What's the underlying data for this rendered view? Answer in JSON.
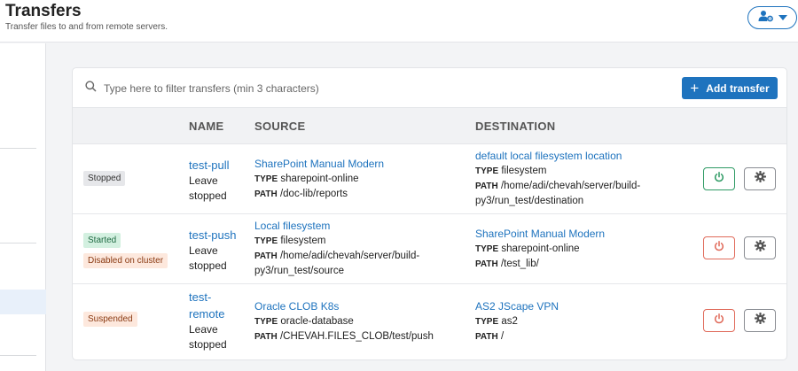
{
  "header": {
    "title": "Transfers",
    "subtitle": "Transfer files to and from remote servers.",
    "user_menu_icon": "user-gear-icon"
  },
  "toolbar": {
    "filter_placeholder": "Type here to filter transfers (min 3 characters)",
    "add_label": "Add transfer"
  },
  "table": {
    "columns": {
      "name": "NAME",
      "source": "SOURCE",
      "destination": "DESTINATION"
    },
    "rows": [
      {
        "badges": [
          "Stopped"
        ],
        "name": "test-pull",
        "state": "Leave stopped",
        "source": {
          "title": "SharePoint Manual Modern",
          "type": "sharepoint-online",
          "path": "/doc-lib/reports"
        },
        "destination": {
          "title": "default local filesystem location",
          "type": "filesystem",
          "path_1": "/home/adi/chevah/server/build-",
          "path_2": "py3/run_test/destination"
        },
        "power_state": "on"
      },
      {
        "badges": [
          "Started",
          "Disabled on cluster"
        ],
        "name": "test-push",
        "state": "Leave stopped",
        "source": {
          "title": "Local filesystem",
          "type": "filesystem",
          "path_1": "/home/adi/chevah/server/build-",
          "path_2": "py3/run_test/source"
        },
        "destination": {
          "title": "SharePoint Manual Modern",
          "type": "sharepoint-online",
          "path": "/test_lib/"
        },
        "power_state": "off"
      },
      {
        "badges": [
          "Suspended"
        ],
        "name_1": "test-",
        "name_2": "remote",
        "state": "Leave stopped",
        "source": {
          "title": "Oracle CLOB K8s",
          "type": "oracle-database",
          "path": "/CHEVAH.FILES_CLOB/test/push"
        },
        "destination": {
          "title": "AS2 JScape VPN",
          "type": "as2",
          "path": "/"
        },
        "power_state": "off"
      }
    ],
    "labels": {
      "type": "TYPE",
      "path": "PATH",
      "leave": "Leave",
      "stopped": "stopped"
    }
  },
  "colors": {
    "accent": "#1e73be",
    "started": "#2e9a64",
    "stopped_power": "#e06a5a"
  }
}
